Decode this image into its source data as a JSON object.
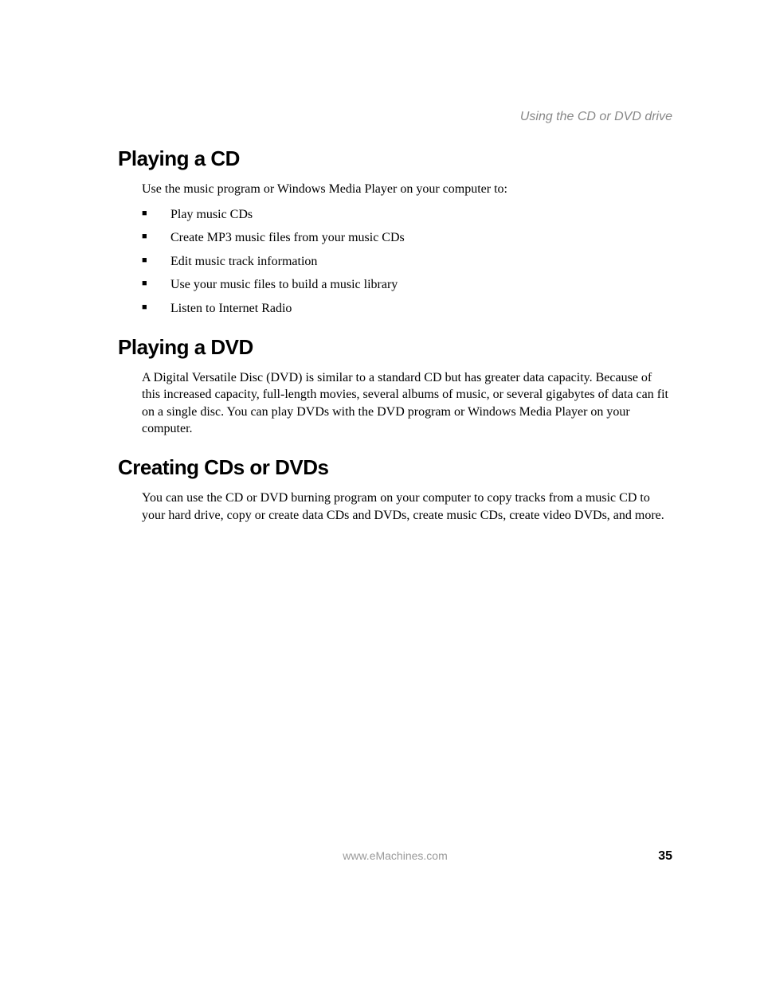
{
  "header": {
    "section_title": "Using the CD or DVD drive"
  },
  "sections": [
    {
      "heading": "Playing a CD",
      "intro": "Use the music program or Windows Media Player on your computer to:",
      "bullets": [
        "Play music CDs",
        "Create MP3 music files from your music CDs",
        "Edit music track information",
        "Use your music files to build a music library",
        "Listen to Internet Radio"
      ]
    },
    {
      "heading": "Playing a DVD",
      "body": "A Digital Versatile Disc (DVD) is similar to a standard CD but has greater data capacity. Because of this increased capacity, full-length movies, several albums of music, or several gigabytes of data can fit on a single disc. You can play DVDs with the DVD program or Windows Media Player on your computer."
    },
    {
      "heading": "Creating CDs or DVDs",
      "body": "You can use the CD or DVD burning program on your computer to copy tracks from a music CD to your hard drive, copy or create data CDs and DVDs, create music CDs, create video DVDs, and more."
    }
  ],
  "footer": {
    "url": "www.eMachines.com",
    "page_number": "35"
  }
}
